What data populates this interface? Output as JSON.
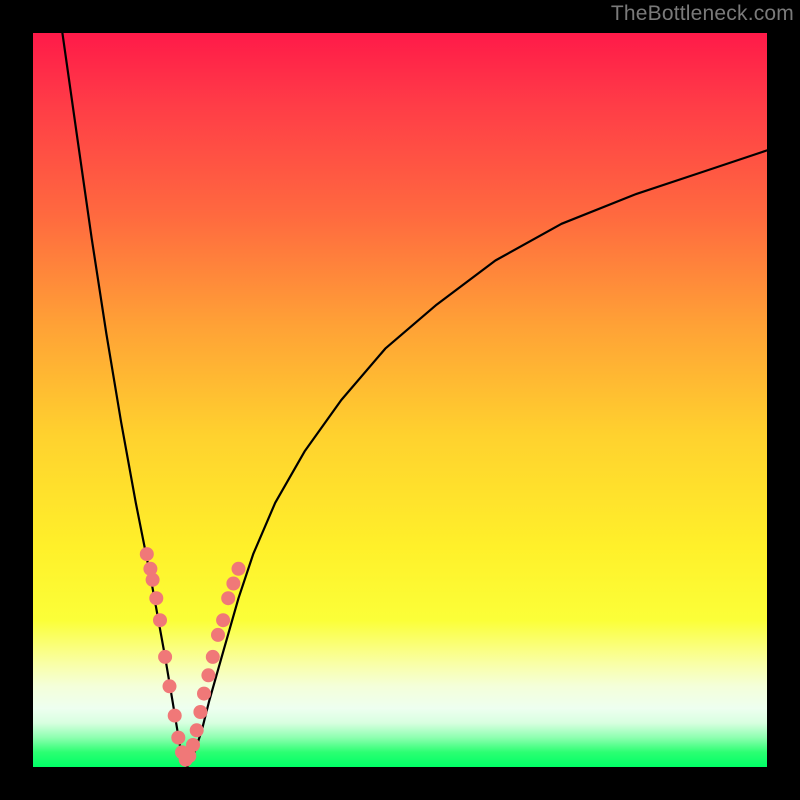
{
  "watermark": "TheBottleneck.com",
  "colors": {
    "frame": "#000000",
    "curve": "#000000",
    "dot_fill": "#f07878",
    "dot_stroke": "#d46060",
    "gradient_top": "#ff1a49",
    "gradient_bottom": "#00ff66"
  },
  "chart_data": {
    "type": "line",
    "title": "",
    "xlabel": "",
    "ylabel": "",
    "xlim": [
      0,
      100
    ],
    "ylim": [
      0,
      100
    ],
    "notes": "V-shaped bottleneck curve. Minimum (0%) around x≈21. Left branch rises sharply to ~100 at x≈4. Right branch rises with diminishing slope to ~84 at x=100. Dots cluster on both branches near the bottom (y roughly 2–30).",
    "series": [
      {
        "name": "curve",
        "x": [
          4,
          6,
          8,
          10,
          12,
          14,
          16,
          18,
          19,
          20,
          21,
          22,
          23,
          24,
          26,
          28,
          30,
          33,
          37,
          42,
          48,
          55,
          63,
          72,
          82,
          91,
          100
        ],
        "y": [
          100,
          86,
          72,
          59,
          47,
          36,
          26,
          15,
          9,
          3,
          0,
          2,
          5,
          9,
          16,
          23,
          29,
          36,
          43,
          50,
          57,
          63,
          69,
          74,
          78,
          81,
          84
        ]
      },
      {
        "name": "dots",
        "x": [
          15.5,
          16.0,
          16.3,
          16.8,
          17.3,
          18.0,
          18.6,
          19.3,
          19.8,
          20.3,
          20.8,
          21.3,
          21.8,
          22.3,
          22.8,
          23.3,
          23.9,
          24.5,
          25.2,
          25.9,
          26.6,
          27.3,
          28.0
        ],
        "y": [
          29.0,
          27.0,
          25.5,
          23.0,
          20.0,
          15.0,
          11.0,
          7.0,
          4.0,
          2.0,
          1.0,
          1.5,
          3.0,
          5.0,
          7.5,
          10.0,
          12.5,
          15.0,
          18.0,
          20.0,
          23.0,
          25.0,
          27.0
        ]
      }
    ]
  }
}
